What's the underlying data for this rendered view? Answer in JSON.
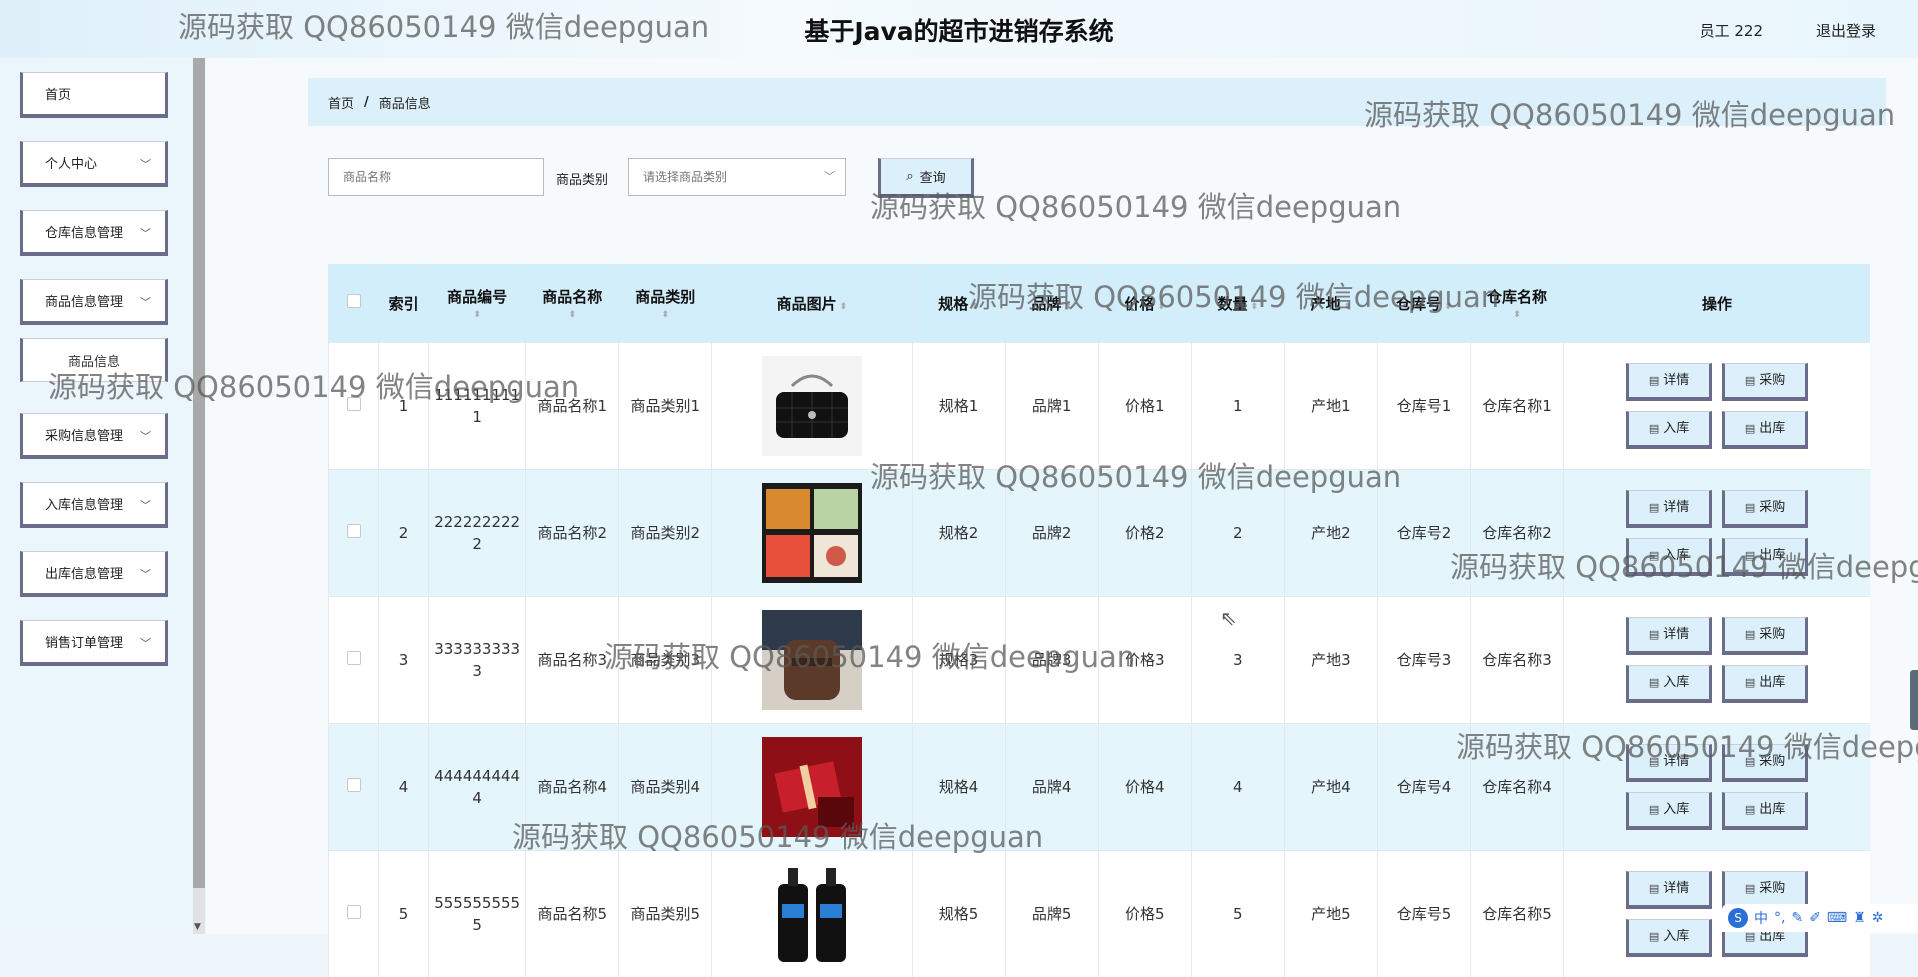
{
  "header": {
    "title": "基于Java的超市进销存系统",
    "user": "员工 222",
    "logout": "退出登录"
  },
  "sidebar": {
    "items": [
      {
        "label": "首页",
        "expandable": false
      },
      {
        "label": "个人中心",
        "expandable": true
      },
      {
        "label": "仓库信息管理",
        "expandable": true
      },
      {
        "label": "商品信息管理",
        "expandable": true
      },
      {
        "label": "商品信息",
        "expandable": false
      },
      {
        "label": "采购信息管理",
        "expandable": true
      },
      {
        "label": "入库信息管理",
        "expandable": true
      },
      {
        "label": "出库信息管理",
        "expandable": true
      },
      {
        "label": "销售订单管理",
        "expandable": true
      }
    ]
  },
  "breadcrumb": {
    "home": "首页",
    "sep": "/",
    "current": "商品信息"
  },
  "search": {
    "name_placeholder": "商品名称",
    "category_label": "商品类别",
    "category_placeholder": "请选择商品类别",
    "button": "查询"
  },
  "table": {
    "headers": {
      "index": "索引",
      "code": "商品编号",
      "name": "商品名称",
      "category": "商品类别",
      "image": "商品图片",
      "spec": "规格",
      "brand": "品牌",
      "price": "价格",
      "qty": "数量",
      "origin": "产地",
      "warehouse_no": "仓库号",
      "warehouse_name": "仓库名称",
      "ops": "操作"
    },
    "ops": {
      "detail": "详情",
      "purchase": "采购",
      "in": "入库",
      "out": "出库"
    },
    "rows": [
      {
        "index": "1",
        "code": "1111111111",
        "name": "商品名称1",
        "category": "商品类别1",
        "image": "black-handbag",
        "spec": "规格1",
        "brand": "品牌1",
        "price": "价格1",
        "qty": "1",
        "origin": "产地1",
        "warehouse_no": "仓库号1",
        "warehouse_name": "仓库名称1"
      },
      {
        "index": "2",
        "code": "2222222222",
        "name": "商品名称2",
        "category": "商品类别2",
        "image": "bento-box",
        "spec": "规格2",
        "brand": "品牌2",
        "price": "价格2",
        "qty": "2",
        "origin": "产地2",
        "warehouse_no": "仓库号2",
        "warehouse_name": "仓库名称2"
      },
      {
        "index": "3",
        "code": "3333333333",
        "name": "商品名称3",
        "category": "商品类别3",
        "image": "brown-bag",
        "spec": "规格3",
        "brand": "品牌3",
        "price": "价格3",
        "qty": "3",
        "origin": "产地3",
        "warehouse_no": "仓库号3",
        "warehouse_name": "仓库名称3"
      },
      {
        "index": "4",
        "code": "4444444444",
        "name": "商品名称4",
        "category": "商品类别4",
        "image": "red-gift",
        "spec": "规格4",
        "brand": "品牌4",
        "price": "价格4",
        "qty": "4",
        "origin": "产地4",
        "warehouse_no": "仓库号4",
        "warehouse_name": "仓库名称4"
      },
      {
        "index": "5",
        "code": "5555555555",
        "name": "商品名称5",
        "category": "商品类别5",
        "image": "mens-bottles",
        "spec": "规格5",
        "brand": "品牌5",
        "price": "价格5",
        "qty": "5",
        "origin": "产地5",
        "warehouse_no": "仓库号5",
        "warehouse_name": "仓库名称5"
      }
    ]
  },
  "watermark": "源码获取 QQ86050149 微信deepguan",
  "ime": {
    "mode": "中"
  },
  "colors": {
    "accent": "#dcf0fb",
    "header_bg": "#d3eefb",
    "border_dark": "#6b6b8a"
  }
}
